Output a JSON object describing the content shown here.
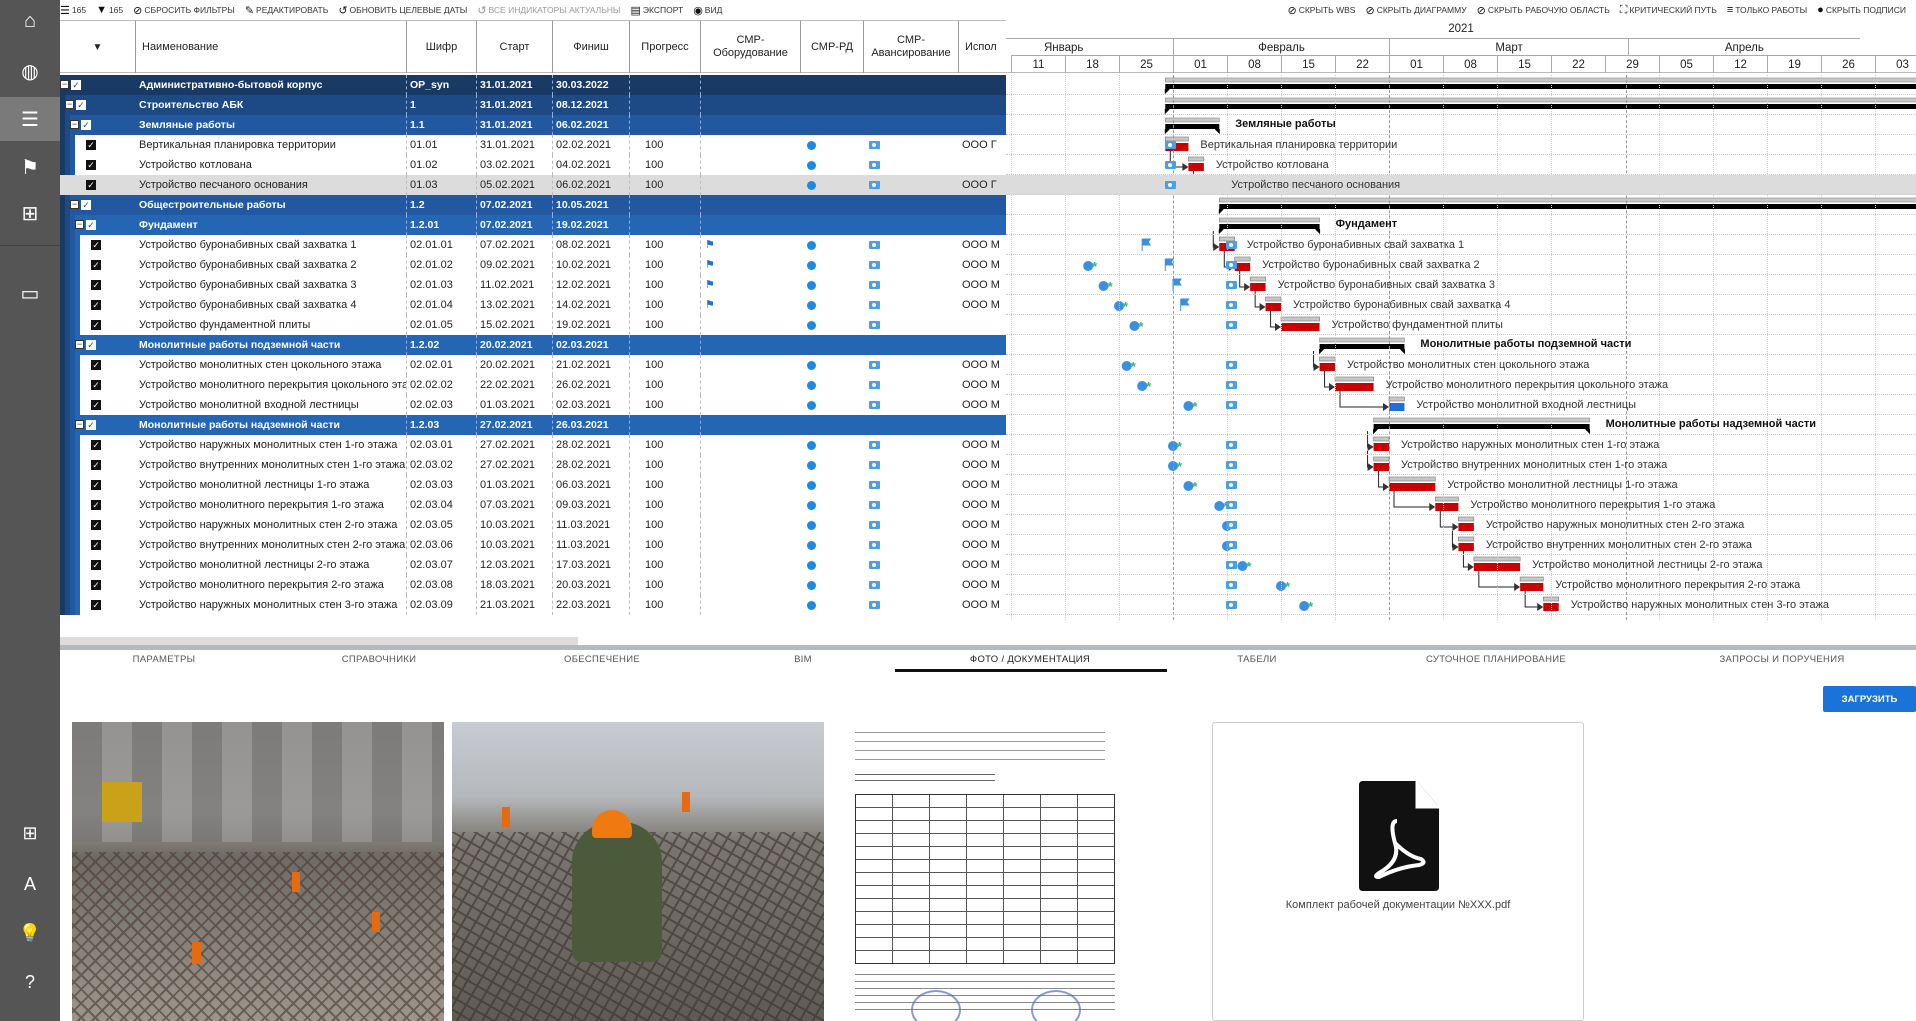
{
  "sidebar": {
    "items": [
      {
        "icon": "home-icon",
        "glyph": "⌂"
      },
      {
        "icon": "globe-icon",
        "glyph": "◍"
      },
      {
        "icon": "gantt-icon",
        "glyph": "☰",
        "active": true
      },
      {
        "icon": "flag-icon",
        "glyph": "⚑"
      },
      {
        "icon": "grid-icon",
        "glyph": "⊞"
      },
      {
        "icon": "book-icon",
        "glyph": "▭"
      }
    ],
    "bottom": [
      {
        "icon": "add-icon",
        "glyph": "⊞"
      },
      {
        "icon": "translate-icon",
        "glyph": "A"
      },
      {
        "icon": "lightbulb-icon",
        "glyph": "💡"
      },
      {
        "icon": "help-icon",
        "glyph": "?"
      }
    ]
  },
  "toolbar": {
    "left": [
      {
        "icon": "list-icon",
        "glyph": "☰",
        "label": "165"
      },
      {
        "icon": "filter-icon",
        "glyph": "▼",
        "label": "165"
      },
      {
        "icon": "reset-filter-icon",
        "glyph": "⊘",
        "label": "СБРОСИТЬ ФИЛЬТРЫ"
      },
      {
        "icon": "edit-icon",
        "glyph": "✎",
        "label": "РЕДАКТИРОВАТЬ"
      },
      {
        "icon": "refresh-icon",
        "glyph": "↺",
        "label": "ОБНОВИТЬ ЦЕЛЕВЫЕ ДАТЫ"
      },
      {
        "icon": "refresh-icon",
        "glyph": "↺",
        "label": "ВСЕ ИНДИКАТОРЫ АКТУАЛЬНЫ",
        "disabled": true
      },
      {
        "icon": "export-icon",
        "glyph": "▤",
        "label": "ЭКСПОРТ"
      },
      {
        "icon": "eye-icon",
        "glyph": "◉",
        "label": "ВИД"
      }
    ],
    "right": [
      {
        "icon": "hide-icon",
        "glyph": "⊘",
        "label": "СКРЫТЬ WBS"
      },
      {
        "icon": "hide-icon",
        "glyph": "⊘",
        "label": "СКРЫТЬ ДИАГРАММУ"
      },
      {
        "icon": "hide-icon",
        "glyph": "⊘",
        "label": "СКРЫТЬ РАБОЧУЮ ОБЛАСТЬ"
      },
      {
        "icon": "critical-path-icon",
        "glyph": "⛶",
        "label": "КРИТИЧЕСКИЙ ПУТЬ"
      },
      {
        "icon": "only-tasks-icon",
        "glyph": "≡",
        "label": "ТОЛЬКО РАБОТЫ"
      },
      {
        "icon": "info-icon",
        "glyph": "●",
        "label": "СКРЫТЬ ПОДПИСИ"
      }
    ]
  },
  "table": {
    "columns": [
      "▼",
      "Наименование",
      "Шифр",
      "Старт",
      "Финиш",
      "Прогресс",
      "СМР-Оборудование",
      "СМР-РД",
      "СМР-Авансирование",
      "Испол"
    ],
    "rows": [
      {
        "level": 0,
        "summary": true,
        "name": "Административно-бытовой корпус",
        "code": "OP_syn",
        "start": "31.01.2021",
        "finish": "30.03.2022"
      },
      {
        "level": 1,
        "summary": true,
        "name": "Строительство АБК",
        "code": "1",
        "start": "31.01.2021",
        "finish": "08.12.2021"
      },
      {
        "level": 2,
        "summary": true,
        "name": "Земляные работы",
        "code": "1.1",
        "start": "31.01.2021",
        "finish": "06.02.2021"
      },
      {
        "level": 3,
        "name": "Вертикальная планировка территории",
        "code": "01.01",
        "start": "31.01.2021",
        "finish": "02.02.2021",
        "progress": "100",
        "rd": true,
        "adv": true,
        "exec": "ООО Г"
      },
      {
        "level": 3,
        "name": "Устройство котлована",
        "code": "01.02",
        "start": "03.02.2021",
        "finish": "04.02.2021",
        "progress": "100",
        "rd": true,
        "adv": true,
        "exec": ""
      },
      {
        "level": 3,
        "name": "Устройство песчаного основания",
        "code": "01.03",
        "start": "05.02.2021",
        "finish": "06.02.2021",
        "progress": "100",
        "rd": true,
        "adv": true,
        "exec": "ООО Г",
        "selected": true
      },
      {
        "level": 2,
        "summary": true,
        "name": "Общестроительные работы",
        "code": "1.2",
        "start": "07.02.2021",
        "finish": "10.05.2021"
      },
      {
        "level": 3,
        "summary": true,
        "name": "Фундамент",
        "code": "1.2.01",
        "start": "07.02.2021",
        "finish": "19.02.2021"
      },
      {
        "level": 4,
        "name": "Устройство буронабивных свай захватка 1",
        "code": "02.01.01",
        "start": "07.02.2021",
        "finish": "08.02.2021",
        "progress": "100",
        "equip": true,
        "rd": true,
        "adv": true,
        "exec": "ООО М"
      },
      {
        "level": 4,
        "name": "Устройство буронабивных свай захватка 2",
        "code": "02.01.02",
        "start": "09.02.2021",
        "finish": "10.02.2021",
        "progress": "100",
        "equip": true,
        "rd": true,
        "adv": true,
        "exec": "ООО М"
      },
      {
        "level": 4,
        "name": "Устройство буронабивных свай захватка 3",
        "code": "02.01.03",
        "start": "11.02.2021",
        "finish": "12.02.2021",
        "progress": "100",
        "equip": true,
        "rd": true,
        "adv": true,
        "exec": "ООО М"
      },
      {
        "level": 4,
        "name": "Устройство буронабивных свай захватка 4",
        "code": "02.01.04",
        "start": "13.02.2021",
        "finish": "14.02.2021",
        "progress": "100",
        "equip": true,
        "rd": true,
        "adv": true,
        "exec": "ООО М"
      },
      {
        "level": 4,
        "name": "Устройство фундаментной плиты",
        "code": "02.01.05",
        "start": "15.02.2021",
        "finish": "19.02.2021",
        "progress": "100",
        "rd": true,
        "adv": true,
        "exec": ""
      },
      {
        "level": 3,
        "summary": true,
        "name": "Монолитные работы подземной части",
        "code": "1.2.02",
        "start": "20.02.2021",
        "finish": "02.03.2021"
      },
      {
        "level": 4,
        "name": "Устройство монолитных стен цокольного этажа",
        "code": "02.02.01",
        "start": "20.02.2021",
        "finish": "21.02.2021",
        "progress": "100",
        "rd": true,
        "adv": true,
        "exec": "ООО М"
      },
      {
        "level": 4,
        "name": "Устройство монолитного перекрытия цокольного этажа",
        "code": "02.02.02",
        "start": "22.02.2021",
        "finish": "26.02.2021",
        "progress": "100",
        "rd": true,
        "adv": true,
        "exec": "ООО М"
      },
      {
        "level": 4,
        "name": "Устройство монолитной входной лестницы",
        "code": "02.02.03",
        "start": "01.03.2021",
        "finish": "02.03.2021",
        "progress": "100",
        "rd": true,
        "adv": true,
        "exec": "ООО М",
        "bar_color": "#1e6fd8"
      },
      {
        "level": 3,
        "summary": true,
        "name": "Монолитные работы надземной части",
        "code": "1.2.03",
        "start": "27.02.2021",
        "finish": "26.03.2021"
      },
      {
        "level": 4,
        "name": "Устройство наружных монолитных стен 1-го этажа",
        "code": "02.03.01",
        "start": "27.02.2021",
        "finish": "28.02.2021",
        "progress": "100",
        "rd": true,
        "adv": true,
        "exec": "ООО М"
      },
      {
        "level": 4,
        "name": "Устройство внутренних монолитных стен 1-го этажа",
        "code": "02.03.02",
        "start": "27.02.2021",
        "finish": "28.02.2021",
        "progress": "100",
        "rd": true,
        "adv": true,
        "exec": "ООО М"
      },
      {
        "level": 4,
        "name": "Устройство монолитной лестницы 1-го этажа",
        "code": "02.03.03",
        "start": "01.03.2021",
        "finish": "06.03.2021",
        "progress": "100",
        "rd": true,
        "adv": true,
        "exec": "ООО М"
      },
      {
        "level": 4,
        "name": "Устройство монолитного перекрытия 1-го этажа",
        "code": "02.03.04",
        "start": "07.03.2021",
        "finish": "09.03.2021",
        "progress": "100",
        "rd": true,
        "adv": true,
        "exec": "ООО М"
      },
      {
        "level": 4,
        "name": "Устройство наружных монолитных стен 2-го этажа",
        "code": "02.03.05",
        "start": "10.03.2021",
        "finish": "11.03.2021",
        "progress": "100",
        "rd": true,
        "adv": true,
        "exec": "ООО М"
      },
      {
        "level": 4,
        "name": "Устройство внутренних монолитных стен 2-го этажа",
        "code": "02.03.06",
        "start": "10.03.2021",
        "finish": "11.03.2021",
        "progress": "100",
        "rd": true,
        "adv": true,
        "exec": "ООО М"
      },
      {
        "level": 4,
        "name": "Устройство монолитной лестницы 2-го этажа",
        "code": "02.03.07",
        "start": "12.03.2021",
        "finish": "17.03.2021",
        "progress": "100",
        "rd": true,
        "adv": true,
        "exec": "ООО М"
      },
      {
        "level": 4,
        "name": "Устройство монолитного перекрытия 2-го этажа",
        "code": "02.03.08",
        "start": "18.03.2021",
        "finish": "20.03.2021",
        "progress": "100",
        "rd": true,
        "adv": true,
        "exec": "ООО М"
      },
      {
        "level": 4,
        "name": "Устройство наружных монолитных стен 3-го этажа",
        "code": "02.03.09",
        "start": "21.03.2021",
        "finish": "22.03.2021",
        "progress": "100",
        "rd": true,
        "adv": true,
        "exec": "ООО М"
      }
    ]
  },
  "gantt": {
    "year": "2021",
    "months": [
      {
        "label": "Январь",
        "start": "01.01.2021",
        "end": "01.02.2021"
      },
      {
        "label": "Февраль",
        "start": "01.02.2021",
        "end": "01.03.2021"
      },
      {
        "label": "Март",
        "start": "01.03.2021",
        "end": "01.04.2021"
      },
      {
        "label": "Апрель",
        "start": "01.04.2021",
        "end": "01.05.2021"
      }
    ],
    "weeks": [
      {
        "label": "11",
        "date": "11.01.2021"
      },
      {
        "label": "18",
        "date": "18.01.2021"
      },
      {
        "label": "25",
        "date": "25.01.2021"
      },
      {
        "label": "01",
        "date": "01.02.2021"
      },
      {
        "label": "08",
        "date": "08.02.2021"
      },
      {
        "label": "15",
        "date": "15.02.2021"
      },
      {
        "label": "22",
        "date": "22.02.2021"
      },
      {
        "label": "01",
        "date": "01.03.2021"
      },
      {
        "label": "08",
        "date": "08.03.2021"
      },
      {
        "label": "15",
        "date": "15.03.2021"
      },
      {
        "label": "22",
        "date": "22.03.2021"
      },
      {
        "label": "29",
        "date": "29.03.2021"
      },
      {
        "label": "05",
        "date": "05.04.2021"
      },
      {
        "label": "12",
        "date": "12.04.2021"
      },
      {
        "label": "19",
        "date": "19.04.2021"
      },
      {
        "label": "26",
        "date": "26.04.2021"
      },
      {
        "label": "03",
        "date": "03.05.2021"
      }
    ],
    "colors": {
      "planned": "#c8c8c8",
      "actual": "#cc0000",
      "summary": "#000000"
    }
  },
  "tabs": {
    "items": [
      "ПАРАМЕТРЫ",
      "СПРАВОЧНИКИ",
      "ОБЕСПЕЧЕНИЕ",
      "BIM",
      "ФОТО / ДОКУМЕНТАЦИЯ",
      "ТАБЕЛИ",
      "СУТОЧНОЕ ПЛАНИРОВАНИЕ",
      "ЗАПРОСЫ И ПОРУЧЕНИЯ"
    ],
    "active": 4
  },
  "documents": {
    "upload_label": "ЗАГРУЗИТЬ",
    "pdf_name": "Комплект рабочей документации №XXX.pdf"
  },
  "colors": {
    "level0": "#1a3a66",
    "level1": "#1d4a85",
    "level2": "#2158a0",
    "level3": "#2566b4",
    "selected": "#dcdcdc",
    "accent": "#1a73d9"
  }
}
